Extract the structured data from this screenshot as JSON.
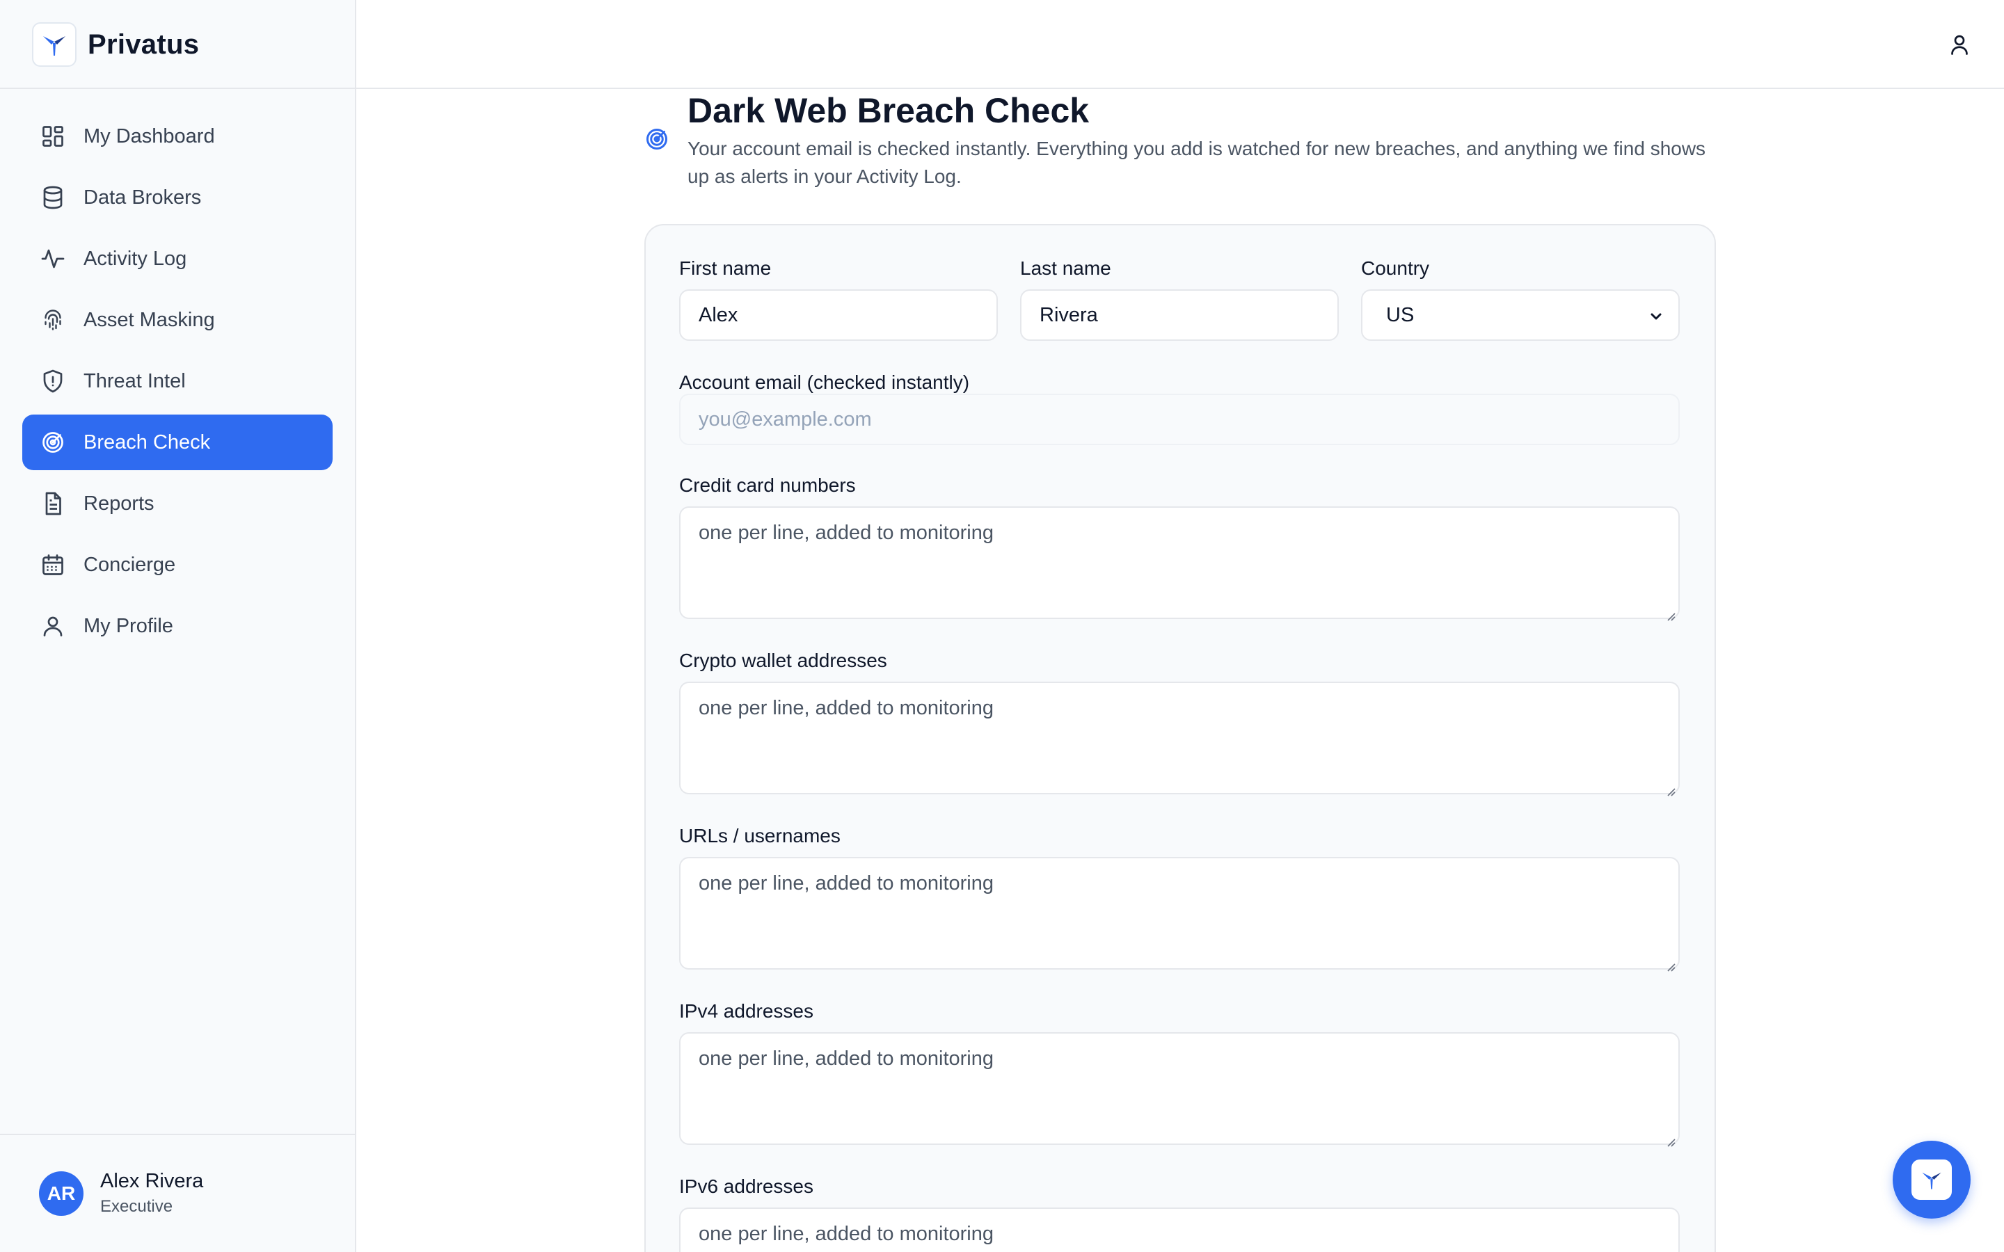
{
  "brand": {
    "name": "Privatus",
    "logo_icon": "privatus-logo-icon"
  },
  "sidebar": {
    "items": [
      {
        "label": "My Dashboard",
        "icon": "dashboard-grid-icon",
        "active": false
      },
      {
        "label": "Data Brokers",
        "icon": "database-icon",
        "active": false
      },
      {
        "label": "Activity Log",
        "icon": "activity-pulse-icon",
        "active": false
      },
      {
        "label": "Asset Masking",
        "icon": "fingerprint-icon",
        "active": false
      },
      {
        "label": "Threat Intel",
        "icon": "shield-alert-icon",
        "active": false
      },
      {
        "label": "Breach Check",
        "icon": "radar-icon",
        "active": true
      },
      {
        "label": "Reports",
        "icon": "document-icon",
        "active": false
      },
      {
        "label": "Concierge",
        "icon": "calendar-icon",
        "active": false
      },
      {
        "label": "My Profile",
        "icon": "user-icon",
        "active": false
      }
    ],
    "user": {
      "initials": "AR",
      "name": "Alex Rivera",
      "role": "Executive"
    }
  },
  "colors": {
    "accent": "#2f6bf0",
    "sidebar_bg": "#f8fafc",
    "card_bg": "#f8fafc",
    "border": "#e5e7eb"
  },
  "page": {
    "title": "Dark Web Breach Check",
    "description": "Your account email is checked instantly. Everything you add is watched for new breaches, and anything we find shows up as alerts in your Activity Log."
  },
  "form": {
    "first_name": {
      "label": "First name",
      "value": "Alex"
    },
    "last_name": {
      "label": "Last name",
      "value": "Rivera"
    },
    "country": {
      "label": "Country",
      "value": "US"
    },
    "email": {
      "label": "Account email (checked instantly)",
      "placeholder": "you@example.com",
      "value": ""
    },
    "credit_cards": {
      "label": "Credit card numbers",
      "placeholder": "one per line, added to monitoring"
    },
    "crypto_wallets": {
      "label": "Crypto wallet addresses",
      "placeholder": "one per line, added to monitoring"
    },
    "urls_usernames": {
      "label": "URLs / usernames",
      "placeholder": "one per line, added to monitoring"
    },
    "ipv4": {
      "label": "IPv4 addresses",
      "placeholder": "one per line, added to monitoring"
    },
    "ipv6": {
      "label": "IPv6 addresses",
      "placeholder": "one per line, added to monitoring"
    }
  }
}
